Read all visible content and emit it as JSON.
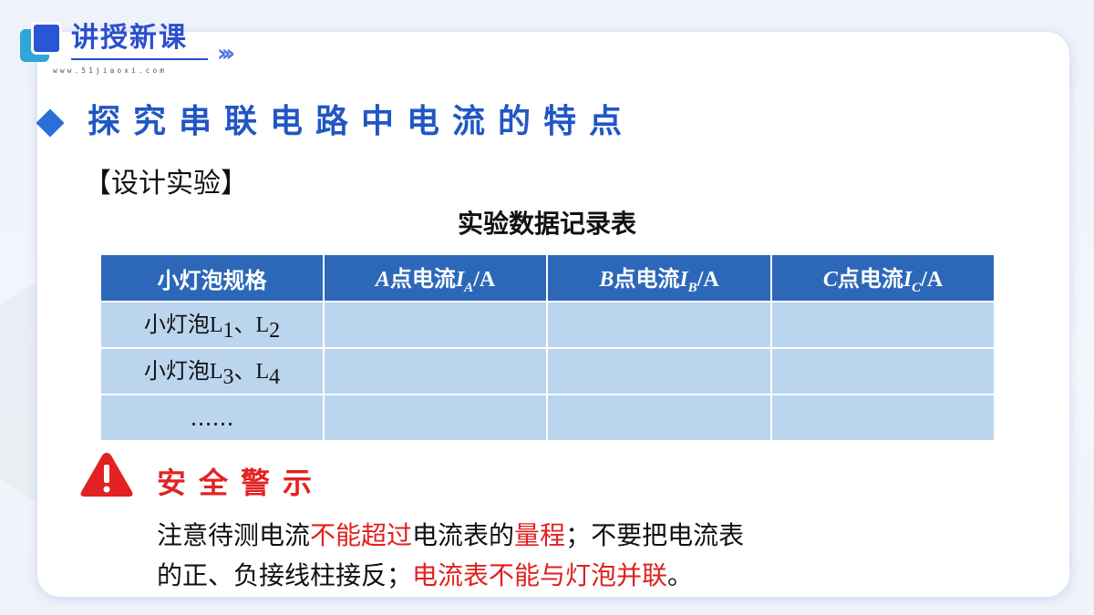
{
  "header": {
    "title": "讲授新课",
    "url": "www.51jiaoxi.com",
    "chevrons": "›››"
  },
  "section": {
    "title": "探究串联电路中电流的特点",
    "design_label": "【设计实验】",
    "table_title": "实验数据记录表"
  },
  "table": {
    "col0": "小灯泡规格",
    "cols": [
      {
        "var": "A",
        "text": "点电流",
        "sym": "I",
        "sub": "A",
        "unit": "/A"
      },
      {
        "var": "B",
        "text": "点电流",
        "sym": "I",
        "sub": "B",
        "unit": "/A"
      },
      {
        "var": "C",
        "text": "点电流",
        "sym": "I",
        "sub": "C",
        "unit": "/A"
      }
    ],
    "rows": [
      {
        "prefix": "小灯泡",
        "l1": "L",
        "s1": "1",
        "sep": "、",
        "l2": "L",
        "s2": "2"
      },
      {
        "prefix": "小灯泡",
        "l1": "L",
        "s1": "3",
        "sep": "、",
        "l2": "L",
        "s2": "4"
      }
    ],
    "ellipsis": "……"
  },
  "warning": {
    "title": "安全警示",
    "icon": "warning-triangle-icon",
    "p1": "注意待测电流",
    "p2": "不能超过",
    "p3": "电流表的",
    "p4": "量程",
    "p5": "；不要把电流表",
    "p6": "的正、负接线柱接反；",
    "p7": "电流表不能与灯泡并联",
    "p8": "。"
  },
  "colors": {
    "brand_blue": "#2a4fcf",
    "header_row": "#2d68b8",
    "cell": "#bcd5ee",
    "warning_red": "#e22222"
  }
}
